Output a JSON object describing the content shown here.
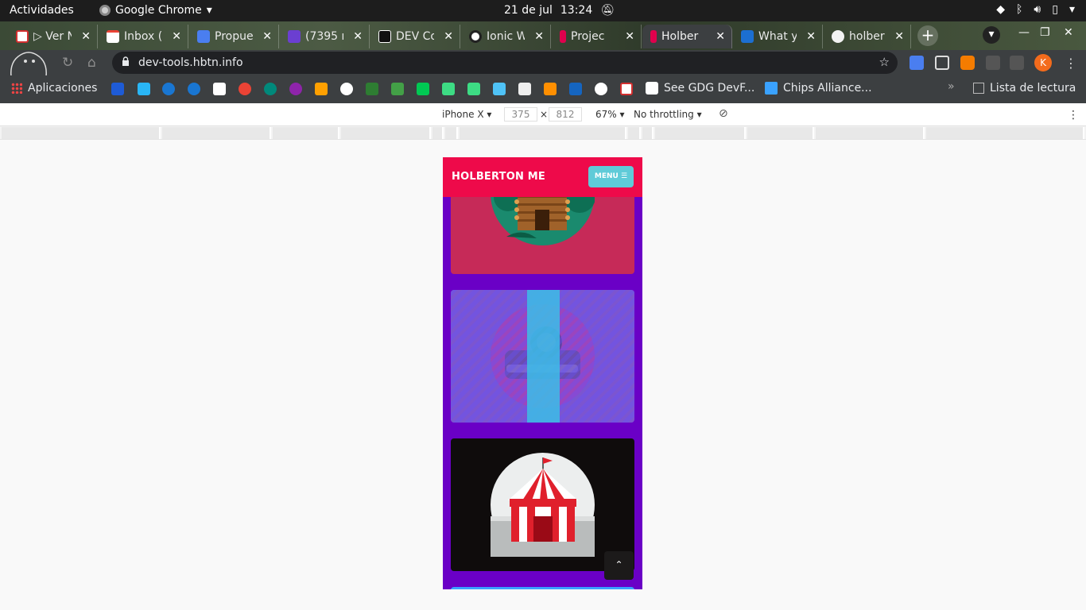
{
  "system_bar": {
    "activities": "Actividades",
    "app_name": "Google Chrome",
    "date": "21 de jul",
    "time": "13:24"
  },
  "tabs": [
    {
      "title": "▷ Ver N",
      "favicon_color": "#d32f2f"
    },
    {
      "title": "Inbox (",
      "favicon_color": "#ea4335"
    },
    {
      "title": "Propue",
      "favicon_color": "#4a7ef0"
    },
    {
      "title": "(7395 n",
      "favicon_color": "#6b3fd1"
    },
    {
      "title": "DEV Co",
      "favicon_color": "#111111"
    },
    {
      "title": "Ionic W",
      "favicon_color": "#f2f2f2"
    },
    {
      "title": "Projec",
      "favicon_color": "#e0004d"
    },
    {
      "title": "Holber",
      "favicon_color": "#e0004d",
      "active": true
    },
    {
      "title": "What y",
      "favicon_color": "#1c6fd1"
    },
    {
      "title": "holber",
      "favicon_color": "#f2f2f2"
    }
  ],
  "omnibox": {
    "url": "dev-tools.hbtn.info"
  },
  "profile_initial": "K",
  "bookmarks": {
    "apps_label": "Aplicaciones",
    "gdg_label": "See GDG DevF...",
    "chips_label": "Chips Alliance...",
    "reading_list": "Lista de lectura"
  },
  "device_toolbar": {
    "device": "iPhone X",
    "width": "375",
    "height": "812",
    "times": "×",
    "zoom": "67%",
    "throttling": "No throttling"
  },
  "site": {
    "title": "HOLBERTON ME",
    "menu_label": "MENU ☰",
    "scroll_top": "⌃"
  },
  "cards": [
    {
      "name": "log-cabin",
      "bg": "#c62a58"
    },
    {
      "name": "camera",
      "bg": "#9868d4"
    },
    {
      "name": "circus-tent",
      "bg": "#0f0c0c"
    }
  ]
}
